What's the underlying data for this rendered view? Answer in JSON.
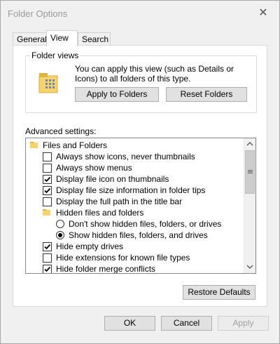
{
  "window": {
    "title": "Folder Options",
    "close_glyph": "✕"
  },
  "tabs": [
    {
      "label": "General",
      "active": false
    },
    {
      "label": "View",
      "active": true
    },
    {
      "label": "Search",
      "active": false
    }
  ],
  "folder_views": {
    "legend": "Folder views",
    "icon": "folder-views-icon",
    "description": "You can apply this view (such as Details or Icons) to all folders of this type.",
    "apply_button": "Apply to Folders",
    "reset_button": "Reset Folders"
  },
  "advanced": {
    "label": "Advanced settings:",
    "items": [
      {
        "type": "folder",
        "label": "Files and Folders"
      },
      {
        "type": "checkbox",
        "label": "Always show icons, never thumbnails",
        "checked": false
      },
      {
        "type": "checkbox",
        "label": "Always show menus",
        "checked": false
      },
      {
        "type": "checkbox",
        "label": "Display file icon on thumbnails",
        "checked": true
      },
      {
        "type": "checkbox",
        "label": "Display file size information in folder tips",
        "checked": true
      },
      {
        "type": "checkbox",
        "label": "Display the full path in the title bar",
        "checked": false
      },
      {
        "type": "folder",
        "label": "Hidden files and folders"
      },
      {
        "type": "radio",
        "label": "Don't show hidden files, folders, or drives",
        "checked": false
      },
      {
        "type": "radio",
        "label": "Show hidden files, folders, and drives",
        "checked": true
      },
      {
        "type": "checkbox",
        "label": "Hide empty drives",
        "checked": true
      },
      {
        "type": "checkbox",
        "label": "Hide extensions for known file types",
        "checked": false
      },
      {
        "type": "checkbox",
        "label": "Hide folder merge conflicts",
        "checked": true
      }
    ],
    "scroll_up_icon": "chevron-up-icon",
    "scroll_down_icon": "chevron-down-icon"
  },
  "restore_defaults": "Restore Defaults",
  "buttons": {
    "ok": "OK",
    "cancel": "Cancel",
    "apply": "Apply"
  },
  "colors": {
    "folder_yellow": "#f6d36b",
    "folder_dark": "#e0b445",
    "disabled_text": "#a0a0a0",
    "button_border": "#adadad",
    "button_face": "#e1e1e1"
  }
}
